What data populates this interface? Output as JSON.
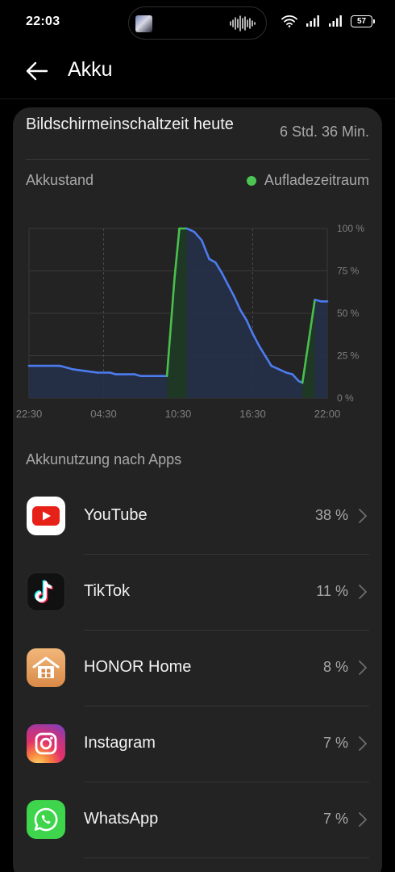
{
  "status_bar": {
    "time": "22:03",
    "battery_level": "57"
  },
  "header": {
    "title": "Akku"
  },
  "screen_time": {
    "label": "Bildschirmeinschaltzeit heute",
    "value": "6 Std. 36 Min."
  },
  "battery_state": {
    "label": "Akkustand",
    "legend_label": "Aufladezeitraum"
  },
  "chart_data": {
    "type": "line",
    "x_ticks": [
      "22:30",
      "04:30",
      "10:30",
      "16:30",
      "22:00"
    ],
    "y_ticks": [
      "100 %",
      "75 %",
      "50 %",
      "25 %",
      "0 %"
    ],
    "ylim": [
      0,
      100
    ],
    "xlim": [
      22.5,
      46.5
    ],
    "series": [
      {
        "values": [
          [
            22.5,
            19
          ],
          [
            25,
            19
          ],
          [
            26,
            17
          ],
          [
            27,
            16
          ],
          [
            28,
            15
          ],
          [
            29,
            15
          ],
          [
            29.5,
            14
          ],
          [
            30,
            14
          ],
          [
            31,
            14
          ],
          [
            31.5,
            13
          ],
          [
            33,
            13
          ],
          [
            33.6,
            13
          ],
          [
            34.2,
            70
          ],
          [
            34.6,
            100
          ],
          [
            35.2,
            100
          ],
          [
            35.8,
            98
          ],
          [
            36.4,
            93
          ],
          [
            37,
            82
          ],
          [
            37.5,
            80
          ],
          [
            38,
            74
          ],
          [
            38.5,
            67
          ],
          [
            39,
            60
          ],
          [
            39.5,
            52
          ],
          [
            40,
            46
          ],
          [
            40.5,
            38
          ],
          [
            41,
            31
          ],
          [
            41.5,
            25
          ],
          [
            42,
            19
          ],
          [
            42.6,
            17
          ],
          [
            43.2,
            15
          ],
          [
            43.7,
            14
          ],
          [
            44.2,
            10
          ],
          [
            44.5,
            9
          ],
          [
            45.5,
            58
          ],
          [
            46,
            57
          ],
          [
            46.5,
            57
          ]
        ]
      }
    ],
    "charging_ranges": [
      [
        33.6,
        35.2
      ],
      [
        44.5,
        45.5
      ]
    ],
    "colors": {
      "line": "#4d7cf0",
      "charging": "#49c04e",
      "fill": "#25304a"
    }
  },
  "apps_section": {
    "title": "Akkunutzung nach Apps",
    "apps": [
      {
        "name": "YouTube",
        "percent": "38 %",
        "icon": "youtube-icon"
      },
      {
        "name": "TikTok",
        "percent": "11 %",
        "icon": "tiktok-icon"
      },
      {
        "name": "HONOR Home",
        "percent": "8 %",
        "icon": "honor-home-icon"
      },
      {
        "name": "Instagram",
        "percent": "7 %",
        "icon": "instagram-icon"
      },
      {
        "name": "WhatsApp",
        "percent": "7 %",
        "icon": "whatsapp-icon"
      }
    ]
  }
}
